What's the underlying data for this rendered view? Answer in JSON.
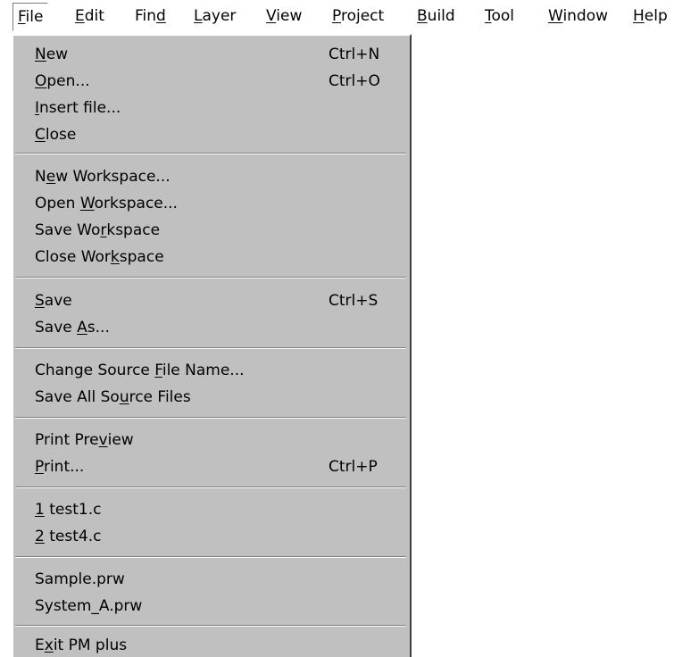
{
  "menubar": {
    "items": [
      {
        "pre": "",
        "mn": "F",
        "post": "ile"
      },
      {
        "pre": "",
        "mn": "E",
        "post": "dit"
      },
      {
        "pre": "Fin",
        "mn": "d",
        "post": ""
      },
      {
        "pre": "",
        "mn": "L",
        "post": "ayer"
      },
      {
        "pre": "",
        "mn": "V",
        "post": "iew"
      },
      {
        "pre": "",
        "mn": "P",
        "post": "roject"
      },
      {
        "pre": "",
        "mn": "B",
        "post": "uild"
      },
      {
        "pre": "",
        "mn": "T",
        "post": "ool"
      },
      {
        "pre": "",
        "mn": "W",
        "post": "indow"
      },
      {
        "pre": "",
        "mn": "H",
        "post": "elp"
      }
    ]
  },
  "file_menu": {
    "items": [
      {
        "pre": "",
        "mn": "N",
        "post": "ew",
        "shortcut": "Ctrl+N"
      },
      {
        "pre": "",
        "mn": "O",
        "post": "pen...",
        "shortcut": "Ctrl+O"
      },
      {
        "pre": "",
        "mn": "I",
        "post": "nsert file...",
        "shortcut": ""
      },
      {
        "pre": "",
        "mn": "C",
        "post": "lose",
        "shortcut": ""
      },
      {
        "pre": "N",
        "mn": "e",
        "post": "w Workspace...",
        "shortcut": ""
      },
      {
        "pre": "Open ",
        "mn": "W",
        "post": "orkspace...",
        "shortcut": ""
      },
      {
        "pre": "Save Wo",
        "mn": "r",
        "post": "kspace",
        "shortcut": ""
      },
      {
        "pre": "Close Wor",
        "mn": "k",
        "post": "space",
        "shortcut": ""
      },
      {
        "pre": "",
        "mn": "S",
        "post": "ave",
        "shortcut": "Ctrl+S"
      },
      {
        "pre": "Save ",
        "mn": "A",
        "post": "s...",
        "shortcut": ""
      },
      {
        "pre": "Change Source ",
        "mn": "F",
        "post": "ile Name...",
        "shortcut": ""
      },
      {
        "pre": "Save All So",
        "mn": "u",
        "post": "rce Files",
        "shortcut": ""
      },
      {
        "pre": "Print Pre",
        "mn": "v",
        "post": "iew",
        "shortcut": ""
      },
      {
        "pre": "",
        "mn": "P",
        "post": "rint...",
        "shortcut": "Ctrl+P"
      },
      {
        "pre": "",
        "mn": "1",
        "post": " test1.c",
        "shortcut": ""
      },
      {
        "pre": "",
        "mn": "2",
        "post": " test4.c",
        "shortcut": ""
      },
      {
        "pre": "Sample.prw",
        "mn": "",
        "post": "",
        "shortcut": ""
      },
      {
        "pre": "System_A.prw",
        "mn": "",
        "post": "",
        "shortcut": ""
      },
      {
        "pre": "E",
        "mn": "x",
        "post": "it PM plus",
        "shortcut": ""
      }
    ]
  }
}
